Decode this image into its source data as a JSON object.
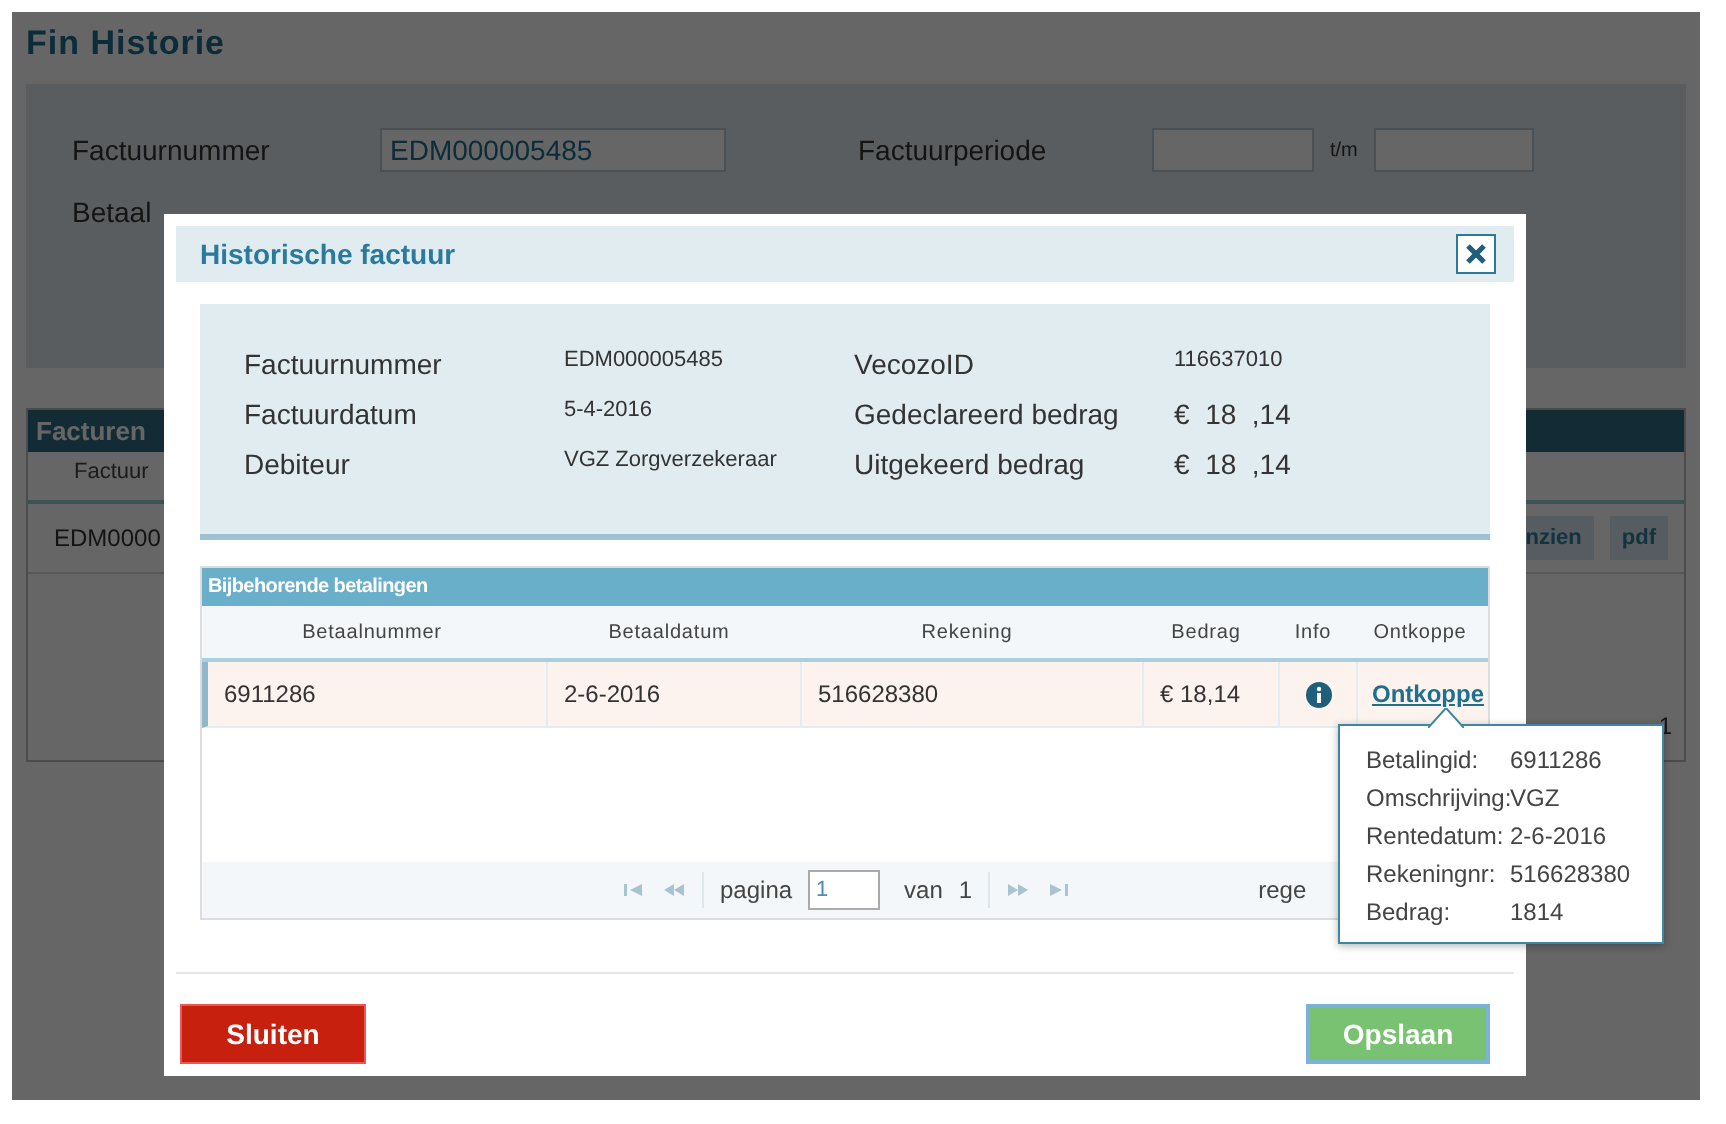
{
  "page": {
    "title": "Fin Historie",
    "filters": [
      {
        "label": "Factuurnummer",
        "value": "EDM000005485"
      },
      {
        "label": "Factuurperiode",
        "separator": "t/m"
      }
    ],
    "filter_row_2": {
      "label": "Betaal"
    },
    "facturen": {
      "title": "Facturen",
      "column": "Factuur",
      "cell": "EDM0000",
      "buttons": [
        "nzien",
        "pdf"
      ],
      "footer": "1"
    }
  },
  "dialog": {
    "title": "Historische factuur",
    "info": [
      {
        "label": "Factuurnummer",
        "value": "EDM000005485"
      },
      {
        "label": "VecozoID",
        "value": "116637010"
      },
      {
        "label": "Factuurdatum",
        "value": "5-4-2016"
      },
      {
        "label": "Gedeclareerd bedrag",
        "value": "€  18  ,14"
      },
      {
        "label": "Debiteur",
        "value": "VGZ Zorgverzekeraar"
      },
      {
        "label": "Uitgekeerd bedrag",
        "value": "€  18  ,14"
      }
    ],
    "payments": {
      "title": "Bijbehorende betalingen",
      "columns": [
        "Betaalnummer",
        "Betaaldatum",
        "Rekening",
        "Bedrag",
        "Info",
        "Ontkoppe"
      ],
      "rows": [
        {
          "cells": [
            "6911286",
            "2-6-2016",
            "516628380",
            "€ 18,14"
          ],
          "link": "Ontkoppe",
          "selected": true
        }
      ],
      "pager": {
        "page_label": "pagina",
        "page": "1",
        "of_label": "van",
        "total": "1",
        "rows_label": "rege"
      }
    },
    "tooltip": [
      {
        "label": "Betalingid:",
        "value": "6911286"
      },
      {
        "label": "Omschrijving:",
        "value": "VGZ"
      },
      {
        "label": "Rentedatum:",
        "value": "2-6-2016"
      },
      {
        "label": "Rekeningnr:",
        "value": "516628380"
      },
      {
        "label": "Bedrag:",
        "value": "1814"
      }
    ],
    "buttons": [
      {
        "label": "Sluiten",
        "kind": "danger"
      },
      {
        "label": "Opslaan",
        "kind": "success"
      }
    ]
  }
}
